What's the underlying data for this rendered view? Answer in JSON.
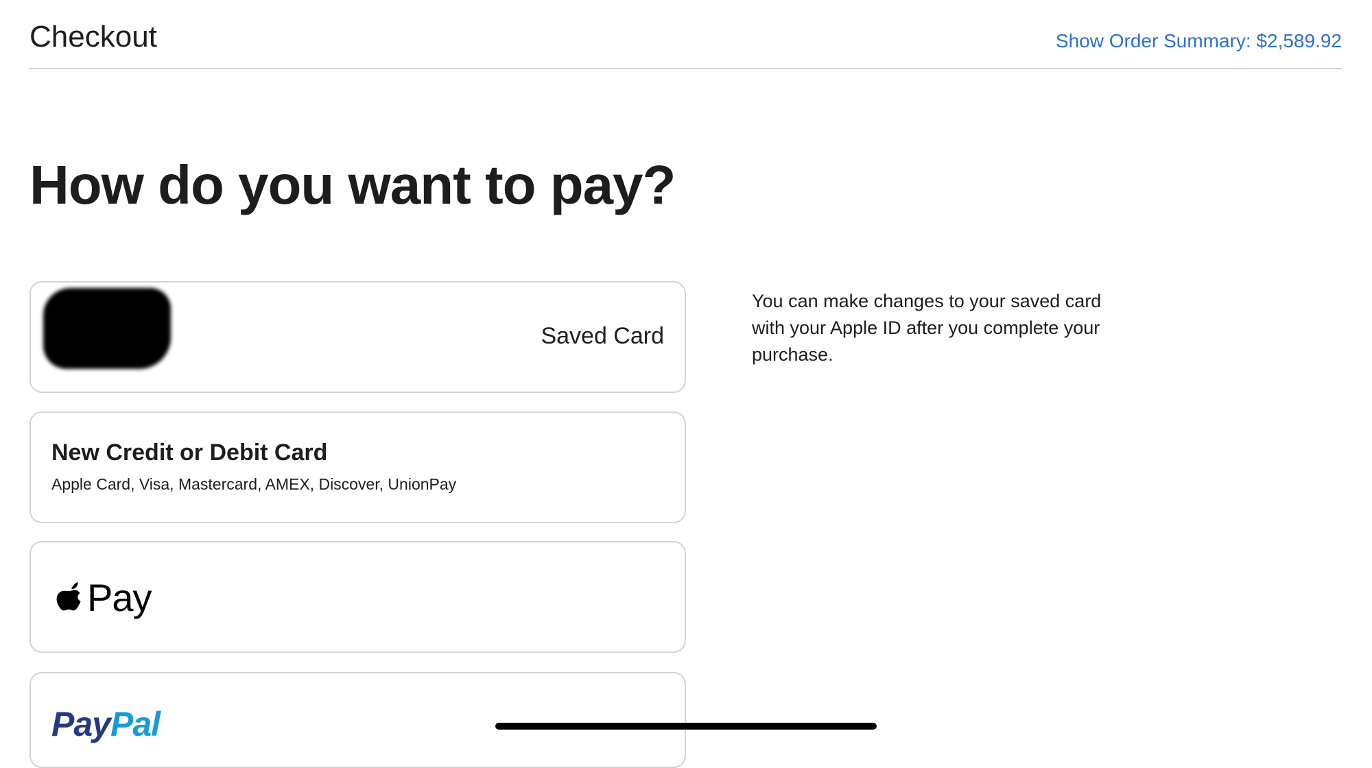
{
  "header": {
    "title": "Checkout",
    "order_summary_link": "Show Order Summary: $2,589.92"
  },
  "main": {
    "heading": "How do you want to pay?",
    "payment_options": {
      "saved_card": {
        "label": "Saved Card"
      },
      "new_card": {
        "title": "New Credit or Debit Card",
        "subtitle": "Apple Card, Visa, Mastercard, AMEX, Discover, UnionPay"
      },
      "apple_pay": {
        "label": "Pay",
        "icon": "apple-logo-icon"
      },
      "paypal": {
        "label_part1": "Pay",
        "label_part2": "Pal"
      }
    },
    "side_note": "You can make changes to your saved card with your Apple ID after you complete your purchase."
  },
  "colors": {
    "link": "#2f6fcf",
    "text": "#1d1d1f",
    "border": "#d2d2d7",
    "paypal_dark": "#253b80",
    "paypal_light": "#179bd7"
  }
}
